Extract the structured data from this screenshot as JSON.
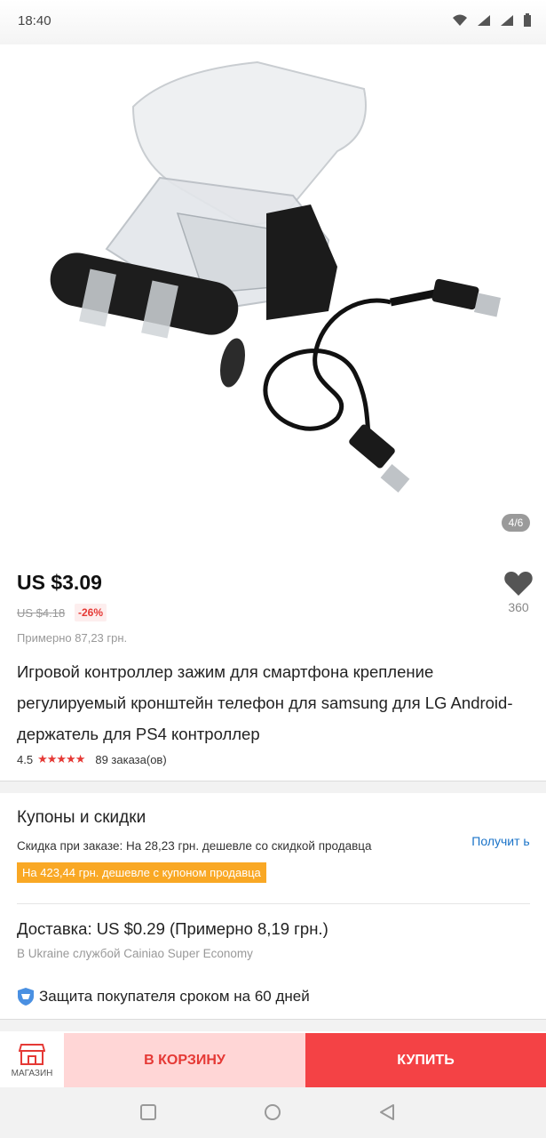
{
  "status_bar": {
    "time": "18:40"
  },
  "gallery": {
    "counter": "4/6"
  },
  "product": {
    "price": "US $3.09",
    "old_price": "US $4.18",
    "discount": "-26%",
    "approx_price": "Примерно 87,23 грн.",
    "wishlist_count": "360",
    "title": "Игровой контроллер зажим для смартфона крепление регулируемый кронштейн телефон для samsung для LG Android-держатель для PS4 контроллер",
    "rating": "4.5",
    "rating_value": 4.5,
    "stars": "★★★★★",
    "orders": "89 заказа(ов)"
  },
  "coupons": {
    "title": "Купоны и скидки",
    "line": "Скидка при заказе: На 28,23 грн. дешевле со скидкой продавца",
    "tag": "На 423,44 грн. дешевле с купоном продавца",
    "get_link": "Получит ь"
  },
  "delivery": {
    "title": "Доставка: US $0.29 (Примерно 8,19 грн.)",
    "subtitle": "В Ukraine службой Cainiao Super Economy"
  },
  "protection": {
    "text": "Защита покупателя сроком на 60 дней"
  },
  "action_bar": {
    "store_label": "МАГАЗИН",
    "add_to_cart_label": "В КОРЗИНУ",
    "buy_label": "КУПИТЬ"
  },
  "colors": {
    "accent": "#f44245",
    "cart_bg": "#ffd6d6",
    "coupon_tag": "#f9a825",
    "link": "#1a73c8"
  }
}
